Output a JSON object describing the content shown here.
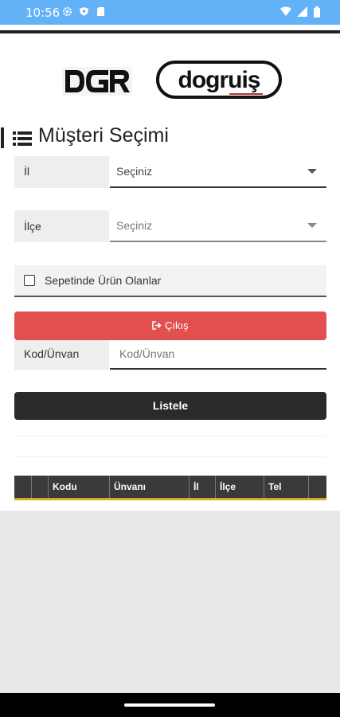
{
  "status_bar": {
    "time": "10:56",
    "left_icons": [
      "settings-icon",
      "shield-icon",
      "sd-card-icon"
    ],
    "right_icons": [
      "wifi-icon",
      "signal-icon",
      "battery-icon"
    ],
    "color": "#63b1f6"
  },
  "brand": {
    "logo_left": "DGR",
    "logo_right": "doğruiş"
  },
  "page": {
    "title": "Müşteri Seçimi",
    "title_icon": "list-icon"
  },
  "form": {
    "il": {
      "label": "İl",
      "value": "Seçiniz"
    },
    "ilce": {
      "label": "İlçe",
      "value": "Seçiniz"
    },
    "checkbox": {
      "label": "Sepetinde Ürün Olanlar",
      "checked": false
    },
    "exit_button": {
      "label": "Çıkış",
      "icon": "sign-out-icon",
      "color": "#e14f4f"
    },
    "kod": {
      "label": "Kod/Ünvan",
      "placeholder": "Kod/Ünvan"
    },
    "list_button": {
      "label": "Listele",
      "color": "#2b2a29"
    }
  },
  "table": {
    "columns": [
      "",
      "",
      "Kodu",
      "Ünvanı",
      "İl",
      "İlçe",
      "Tel",
      ""
    ],
    "accent_color": "#d7a827"
  }
}
